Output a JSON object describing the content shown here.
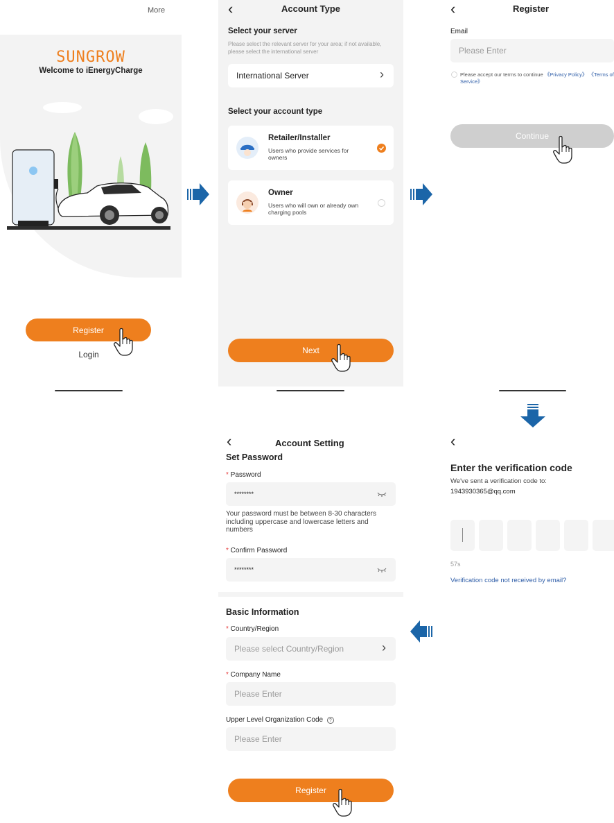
{
  "screen1": {
    "more": "More",
    "brand": "SUNGROW",
    "welcome": "Welcome to iEnergyCharge",
    "register_btn": "Register",
    "login_link": "Login"
  },
  "screen2": {
    "title": "Account Type",
    "server_heading": "Select your server",
    "server_hint": "Please select the relevant server for your area; if not available, please select the international server",
    "server_value": "International Server",
    "account_heading": "Select your account type",
    "options": [
      {
        "title": "Retailer/Installer",
        "desc": "Users who provide services for owners",
        "selected": true
      },
      {
        "title": "Owner",
        "desc": "Users who will own or already own charging pools",
        "selected": false
      }
    ],
    "next_btn": "Next"
  },
  "screen3": {
    "title": "Register",
    "email_label": "Email",
    "email_placeholder": "Please Enter",
    "terms_prefix": "Please accept our terms to continue",
    "privacy_link": "《Privacy Policy》",
    "service_link": "《Terms of Service》",
    "continue_btn": "Continue"
  },
  "screen4": {
    "heading": "Enter the verification code",
    "sent_to": "We've sent a verification code to:",
    "email": "1943930365@qq.com",
    "countdown": "57s",
    "resend_link": "Verification code not received by email?"
  },
  "screen5": {
    "title": "Account Setting",
    "set_password": "Set Password",
    "password_label": "Password",
    "password_value": "********",
    "password_hint": "Your password must be between 8-30 characters including uppercase and lowercase letters and numbers",
    "confirm_label": "Confirm Password",
    "confirm_value": "********",
    "basic_info": "Basic Information",
    "country_label": "Country/Region",
    "country_placeholder": "Please select Country/Region",
    "company_label": "Company Name",
    "company_placeholder": "Please Enter",
    "org_label": "Upper Level Organization Code",
    "org_placeholder": "Please Enter",
    "register_btn": "Register"
  },
  "colors": {
    "accent": "#ee7f1e",
    "link": "#2f5ea8",
    "arrow": "#1b65a8",
    "disabled": "#cfcfcf"
  }
}
